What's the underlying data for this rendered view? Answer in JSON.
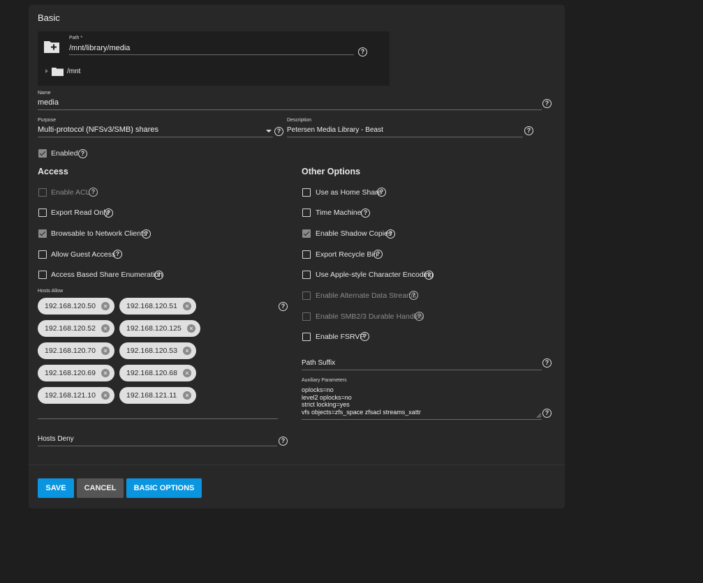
{
  "section_basic": "Basic",
  "path": {
    "label": "Path *",
    "value": "/mnt/library/media",
    "tree_root": "/mnt"
  },
  "name": {
    "label": "Name",
    "value": "media"
  },
  "purpose": {
    "label": "Purpose",
    "value": "Multi-protocol (NFSv3/SMB) shares"
  },
  "description": {
    "label": "Description",
    "value": "Petersen Media Library - Beast"
  },
  "enabled": {
    "label": "Enabled",
    "checked": true
  },
  "access": {
    "title": "Access",
    "options": [
      {
        "label": "Enable ACL",
        "checked": false,
        "disabled": true
      },
      {
        "label": "Export Read Only",
        "checked": false,
        "disabled": false
      },
      {
        "label": "Browsable to Network Clients",
        "checked": true,
        "disabled": false
      },
      {
        "label": "Allow Guest Access",
        "checked": false,
        "disabled": false
      },
      {
        "label": "Access Based Share Enumeration",
        "checked": false,
        "disabled": false
      }
    ],
    "hosts_allow_label": "Hosts Allow",
    "hosts_allow": [
      "192.168.120.50",
      "192.168.120.51",
      "192.168.120.52",
      "192.168.120.125",
      "192.168.120.70",
      "192.168.120.53",
      "192.168.120.69",
      "192.168.120.68",
      "192.168.121.10",
      "192.168.121.11"
    ],
    "hosts_deny_label": "Hosts Deny"
  },
  "other": {
    "title": "Other Options",
    "options": [
      {
        "label": "Use as Home Share",
        "checked": false,
        "disabled": false
      },
      {
        "label": "Time Machine",
        "checked": false,
        "disabled": false
      },
      {
        "label": "Enable Shadow Copies",
        "checked": true,
        "disabled": false
      },
      {
        "label": "Export Recycle Bin",
        "checked": false,
        "disabled": false
      },
      {
        "label": "Use Apple-style Character Encoding",
        "checked": false,
        "disabled": false
      },
      {
        "label": "Enable Alternate Data Streams",
        "checked": false,
        "disabled": true
      },
      {
        "label": "Enable SMB2/3 Durable Handles",
        "checked": false,
        "disabled": true
      },
      {
        "label": "Enable FSRVP",
        "checked": false,
        "disabled": false
      }
    ],
    "path_suffix_label": "Path Suffix",
    "aux_label": "Auxiliary Parameters",
    "aux_lines": [
      "oplocks=no",
      "level2 oplocks=no",
      "strict locking=yes",
      "vfs objects=zfs_space zfsacl streams_xattr"
    ]
  },
  "buttons": {
    "save": "SAVE",
    "cancel": "CANCEL",
    "basic": "BASIC OPTIONS"
  },
  "colors": {
    "primary": "#0a95e0",
    "card": "#282828",
    "background": "#1e1e1e"
  }
}
